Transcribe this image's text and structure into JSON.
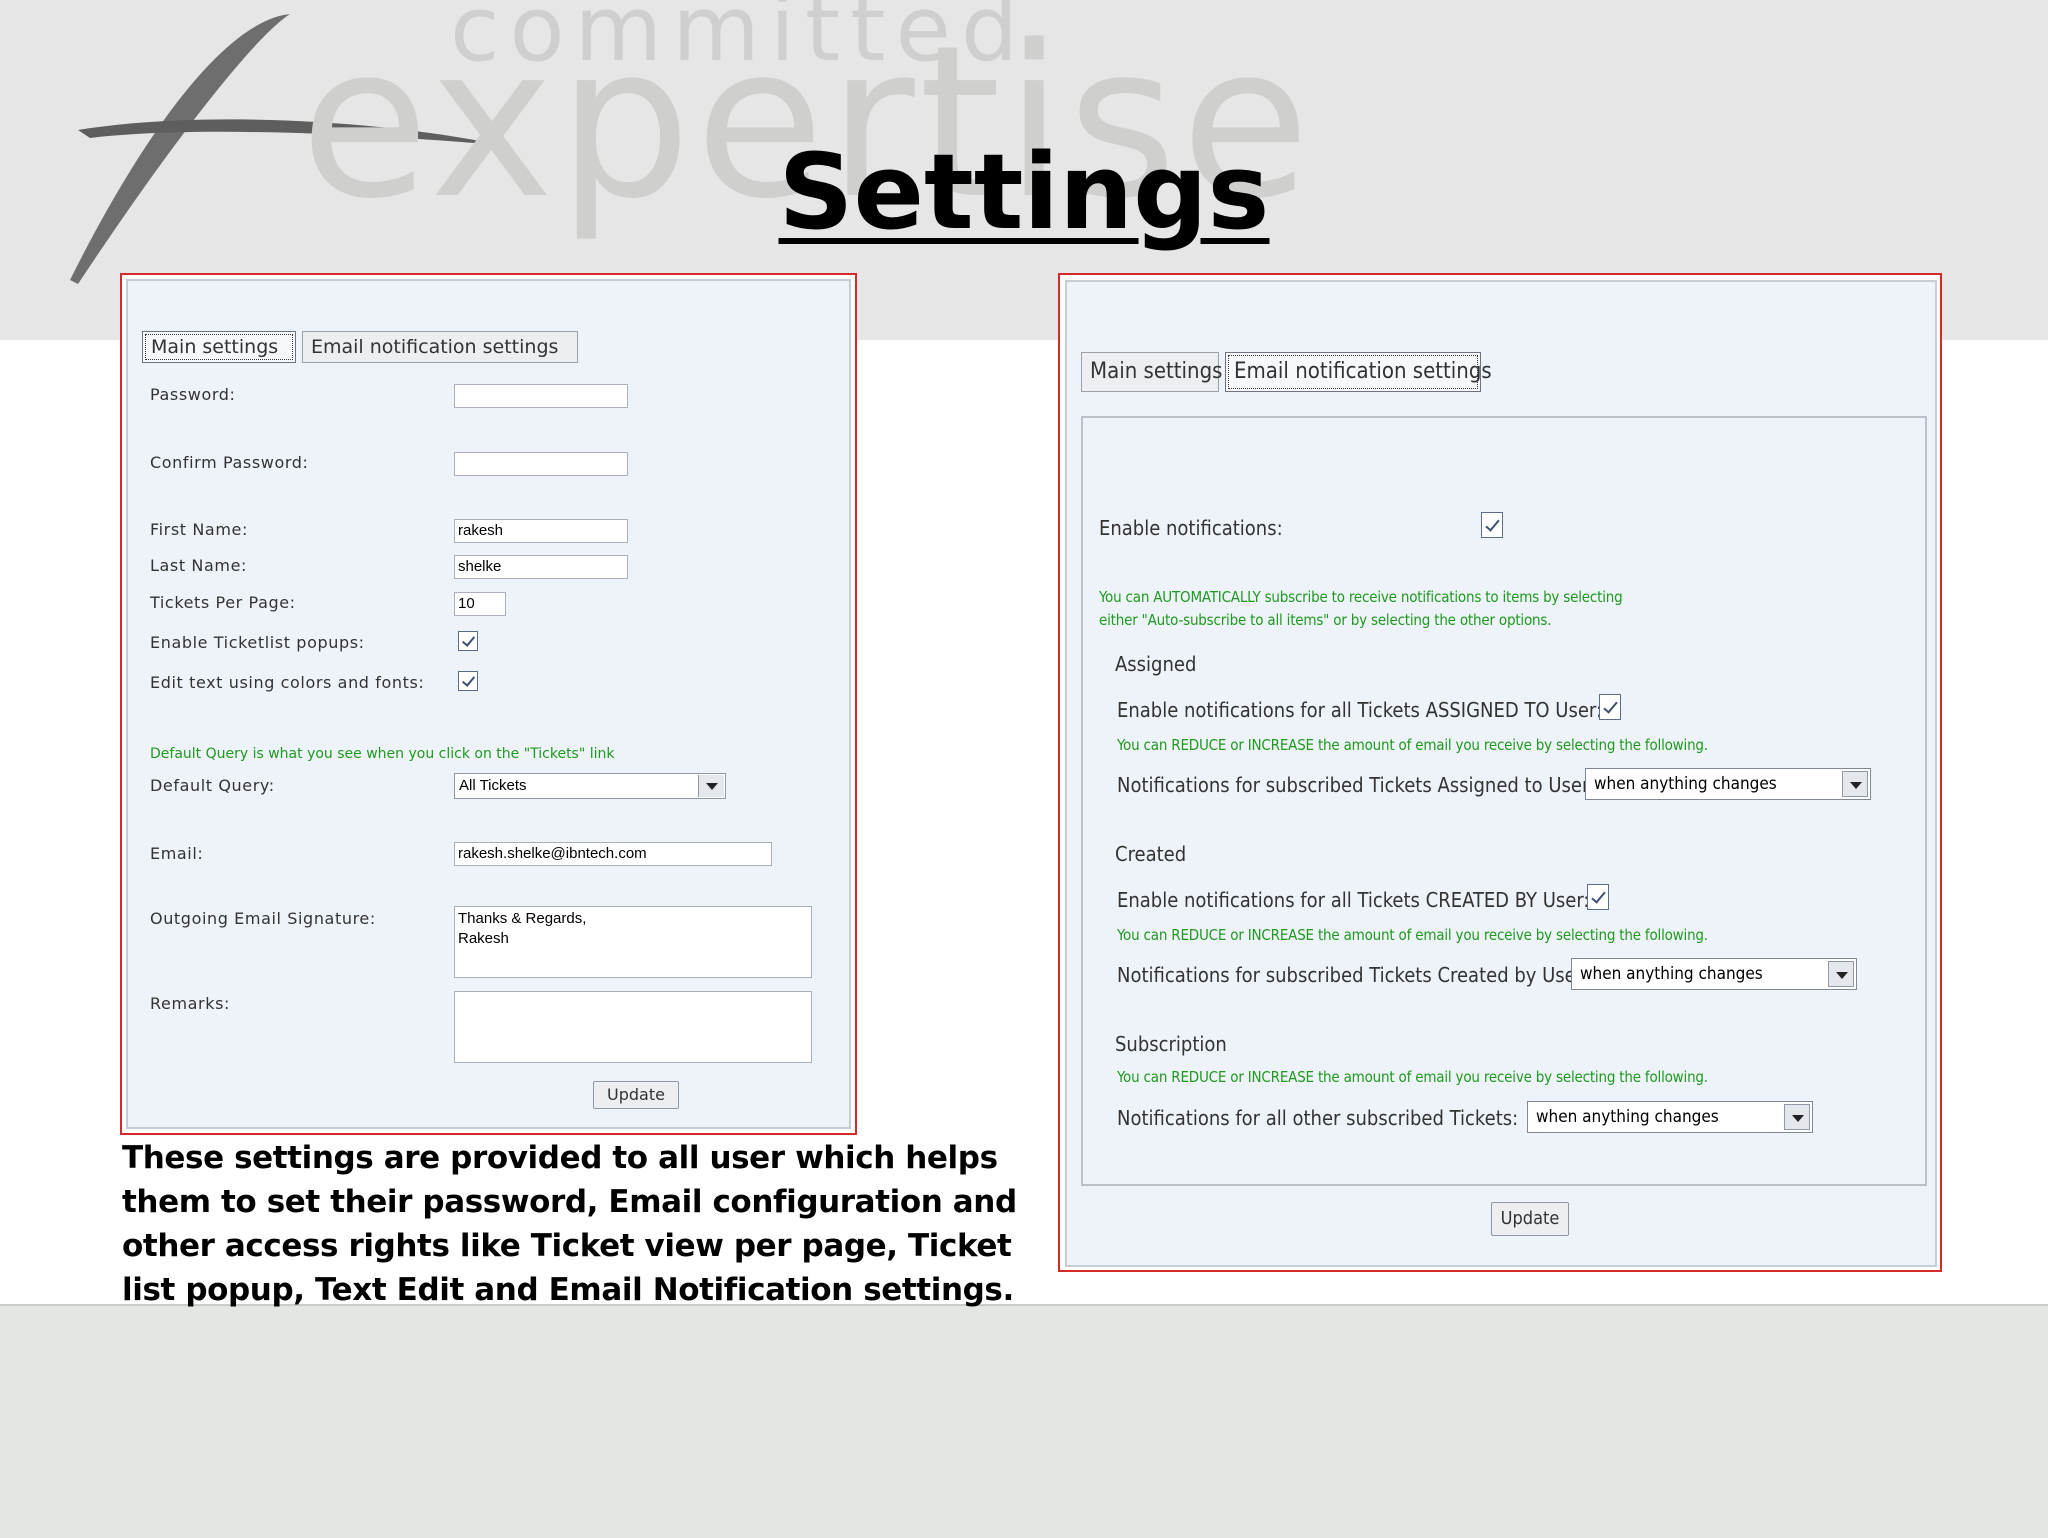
{
  "slide": {
    "title": "Settings",
    "caption": "These settings are provided to all user which helps them to set their password, Email configuration and other access rights like Ticket view per page, Ticket list popup, Text Edit and Email Notification settings."
  },
  "left_panel": {
    "tabs": [
      {
        "label": "Main settings",
        "active": true
      },
      {
        "label": "Email notification settings",
        "active": false
      }
    ],
    "fields": {
      "password": {
        "label": "Password:",
        "value": ""
      },
      "confirm_password": {
        "label": "Confirm Password:",
        "value": ""
      },
      "first_name": {
        "label": "First Name:",
        "value": "rakesh"
      },
      "last_name": {
        "label": "Last Name:",
        "value": "shelke"
      },
      "tickets_per_page": {
        "label": "Tickets Per Page:",
        "value": "10"
      },
      "enable_ticketlist_popups": {
        "label": "Enable Ticketlist popups:",
        "checked": true
      },
      "edit_text_colors": {
        "label": "Edit text using colors and fonts:",
        "checked": true
      },
      "default_query_hint": "Default Query is what you see when you click on the \"Tickets\" link",
      "default_query": {
        "label": "Default Query:",
        "value": "All Tickets"
      },
      "email": {
        "label": "Email:",
        "value": "rakesh.shelke@ibntech.com"
      },
      "signature": {
        "label": "Outgoing Email Signature:",
        "value": "Thanks & Regards,\nRakesh"
      },
      "remarks": {
        "label": "Remarks:",
        "value": ""
      }
    },
    "update_label": "Update"
  },
  "right_panel": {
    "tabs": [
      {
        "label": "Main settings",
        "active": false
      },
      {
        "label": "Email notification settings",
        "active": true
      }
    ],
    "enable_notifications": {
      "label": "Enable notifications:",
      "checked": true
    },
    "auto_subscribe_hint_1": "You can AUTOMATICALLY subscribe to receive notifications to items by selecting",
    "auto_subscribe_hint_2": "either \"Auto-subscribe to all items\" or by selecting the other options.",
    "assigned": {
      "heading": "Assigned",
      "enable_label": "Enable notifications for all Tickets ASSIGNED TO User:",
      "checked": true,
      "hint": "You can REDUCE or INCREASE the amount of email you receive by selecting the following.",
      "select_label": "Notifications for subscribed Tickets Assigned to User:",
      "select_value": "when anything changes"
    },
    "created": {
      "heading": "Created",
      "enable_label": "Enable notifications for all Tickets CREATED BY User:",
      "checked": true,
      "hint": "You can REDUCE or INCREASE the amount of email you receive by selecting the following.",
      "select_label": "Notifications for subscribed Tickets Created by User:",
      "select_value": "when anything changes"
    },
    "subscription": {
      "heading": "Subscription",
      "hint": "You can REDUCE or INCREASE the amount of email you receive by selecting the following.",
      "select_label": "Notifications for all other subscribed Tickets:",
      "select_value": "when anything changes"
    },
    "update_label": "Update"
  },
  "colors": {
    "frame_red": "#d42a2a",
    "panel_bg": "#eef2f9",
    "hint_green": "#1e9a1e"
  }
}
